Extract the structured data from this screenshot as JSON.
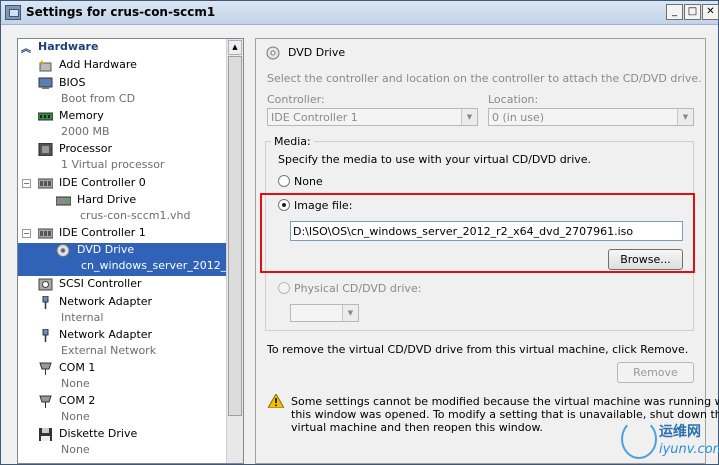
{
  "window": {
    "title": "Settings for crus-con-sccm1",
    "min_glyph": "_",
    "max_glyph": "□",
    "close_glyph": "✕"
  },
  "tree": {
    "header": "Hardware",
    "items": [
      {
        "label": "Add Hardware",
        "sub": "",
        "icon": "add-hardware-icon"
      },
      {
        "label": "BIOS",
        "sub": "Boot from CD",
        "icon": "bios-icon"
      },
      {
        "label": "Memory",
        "sub": "2000 MB",
        "icon": "memory-icon"
      },
      {
        "label": "Processor",
        "sub": "1 Virtual processor",
        "icon": "processor-icon"
      },
      {
        "label": "IDE Controller 0",
        "sub": "",
        "icon": "controller-icon"
      },
      {
        "label": "Hard Drive",
        "sub": "crus-con-sccm1.vhd",
        "icon": "hard-drive-icon"
      },
      {
        "label": "IDE Controller 1",
        "sub": "",
        "icon": "controller-icon"
      },
      {
        "label": "DVD Drive",
        "sub": "cn_windows_server_2012_...",
        "icon": "dvd-icon"
      },
      {
        "label": "SCSI Controller",
        "sub": "",
        "icon": "scsi-icon"
      },
      {
        "label": "Network Adapter",
        "sub": "Internal",
        "icon": "network-adapter-icon"
      },
      {
        "label": "Network Adapter",
        "sub": "External Network",
        "icon": "network-adapter-icon"
      },
      {
        "label": "COM 1",
        "sub": "None",
        "icon": "com-port-icon"
      },
      {
        "label": "COM 2",
        "sub": "None",
        "icon": "com-port-icon"
      },
      {
        "label": "Diskette Drive",
        "sub": "None",
        "icon": "diskette-icon"
      }
    ]
  },
  "detail": {
    "section_title": "DVD Drive",
    "description": "Select the controller and location on the controller to attach the CD/DVD drive.",
    "controller_label": "Controller:",
    "controller_value": "IDE Controller 1",
    "location_label": "Location:",
    "location_value": "0 (in use)",
    "media_label": "Media:",
    "media_desc": "Specify the media to use with your virtual CD/DVD drive.",
    "none_label": "None",
    "image_file_label": "Image file:",
    "image_file_path": "D:\\ISO\\OS\\cn_windows_server_2012_r2_x64_dvd_2707961.iso",
    "browse_label": "Browse...",
    "physical_label": "Physical CD/DVD drive:",
    "remove_text": "To remove the virtual CD/DVD drive from this virtual machine, click Remove.",
    "remove_label": "Remove",
    "warning_line1": "Some settings cannot be modified because the virtual machine was running when",
    "warning_line2": "this window was opened. To modify a setting that is unavailable, shut down the",
    "warning_line3": "virtual machine and then reopen this window."
  },
  "watermark": {
    "cn": "运维网",
    "en": "iyunv.com"
  }
}
